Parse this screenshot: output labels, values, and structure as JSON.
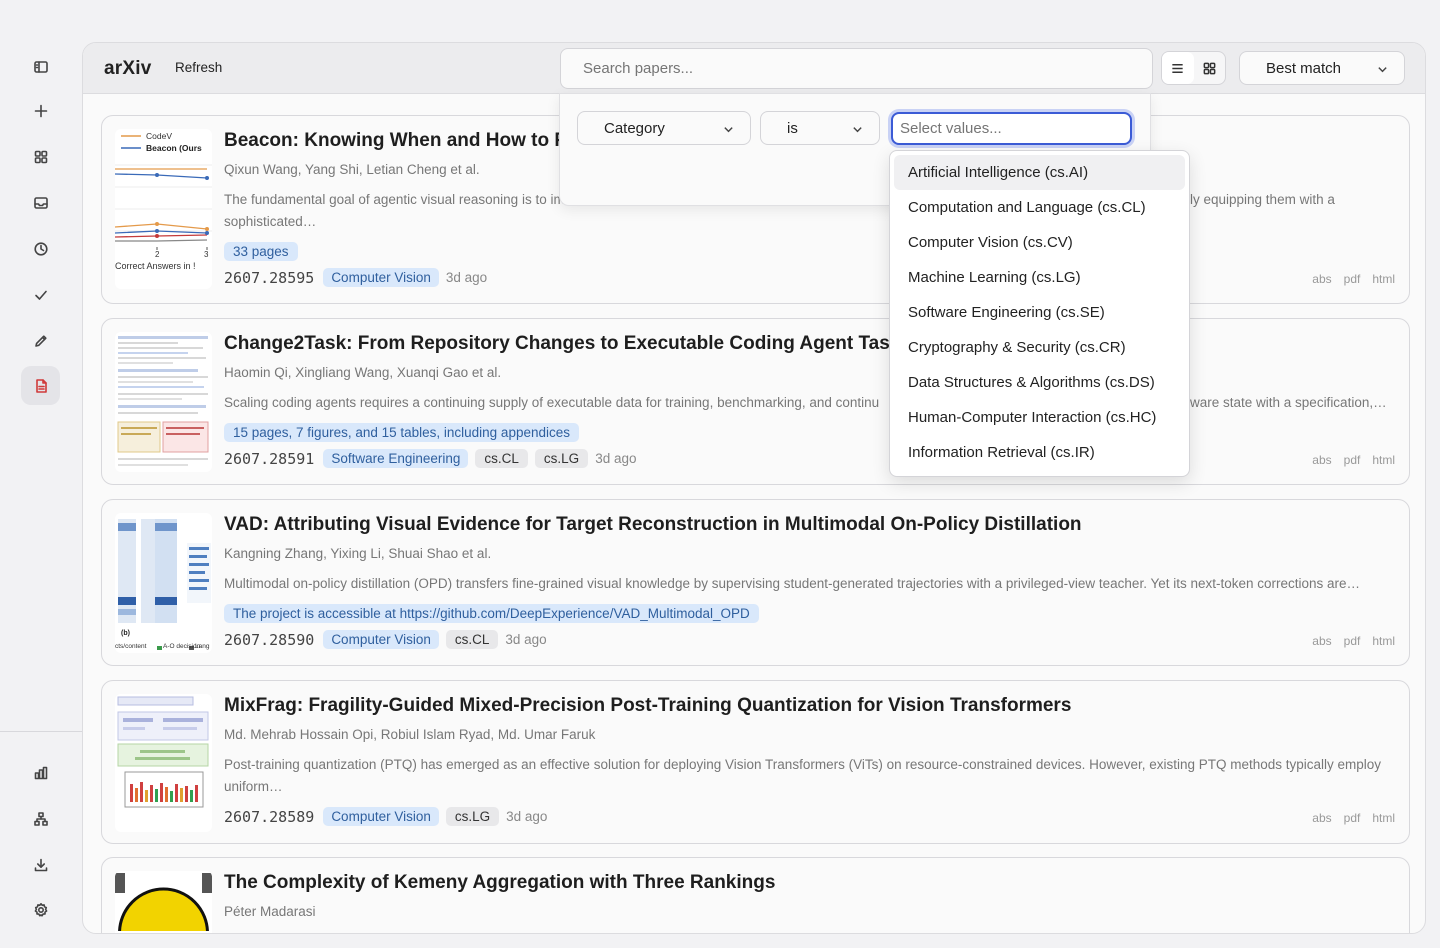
{
  "rail": {
    "top_items": [
      "sidebar-toggle-icon",
      "plus-icon",
      "grid-icon",
      "inbox-icon",
      "clock-icon",
      "check-icon",
      "pencil-icon",
      "document-icon"
    ],
    "bottom_items": [
      "bar-chart-icon",
      "network-icon",
      "download-icon",
      "gear-icon"
    ],
    "active": "document-icon"
  },
  "header": {
    "title": "arXiv",
    "refresh_label": "Refresh",
    "search_placeholder": "Search papers...",
    "sort_label": "Best match"
  },
  "filter": {
    "field": "Category",
    "operator": "is",
    "values_placeholder": "Select values...",
    "options": [
      "Artificial Intelligence (cs.AI)",
      "Computation and Language (cs.CL)",
      "Computer Vision (cs.CV)",
      "Machine Learning (cs.LG)",
      "Software Engineering (cs.SE)",
      "Cryptography & Security (cs.CR)",
      "Data Structures & Algorithms (cs.DS)",
      "Human-Computer Interaction (cs.HC)",
      "Information Retrieval (cs.IR)"
    ]
  },
  "papers": [
    {
      "title": "Beacon: Knowing When and How to Pe",
      "authors": "Qixun Wang, Yang Shi, Letian Cheng et al.",
      "abstract_1": "The fundamental goal of agentic visual reasoning is to im",
      "abstract_1b": "ly equipping them with a",
      "abstract_2": "sophisticated…",
      "note": "33 pages",
      "id": "2607.28595",
      "primary": "Computer Vision",
      "secondary": [],
      "age": "3d ago",
      "thumb_text": [
        "CodeV",
        "Beacon (Ours",
        "2",
        "3",
        "Correct Answers in !"
      ]
    },
    {
      "title": "Change2Task: From Repository Changes to Executable Coding Agent Tasks ar",
      "authors": "Haomin Qi, Xingliang Wang, Xuanqi Gao et al.",
      "abstract_1": "Scaling coding agents requires a continuing supply of executable data for training, benchmarking, and continu",
      "abstract_1b": "ware state with a specification,…",
      "note": "15 pages, 7 figures, and 15 tables, including appendices",
      "id": "2607.28591",
      "primary": "Software Engineering",
      "secondary": [
        "cs.CL",
        "cs.LG"
      ],
      "age": "3d ago"
    },
    {
      "title": "VAD: Attributing Visual Evidence for Target Reconstruction in Multimodal On-Policy Distillation",
      "authors": "Kangning Zhang, Yixing Li, Shuai Shao et al.",
      "abstract_1": "Multimodal on-policy distillation (OPD) transfers fine-grained visual knowledge by supervising student-generated trajectories with a privileged-view teacher. Yet its next-token corrections are…",
      "note": "The project is accessible at https://github.com/DeepExperience/VAD_Multimodal_OPD",
      "id": "2607.28590",
      "primary": "Computer Vision",
      "secondary": [
        "cs.CL"
      ],
      "age": "3d ago",
      "thumb_text": [
        "(b)",
        "cts/content",
        "A-O decision",
        "Lang"
      ]
    },
    {
      "title": "MixFrag: Fragility-Guided Mixed-Precision Post-Training Quantization for Vision Transformers",
      "authors": "Md. Mehrab Hossain Opi, Robiul Islam Ryad, Md. Umar Faruk",
      "abstract_1": "Post-training quantization (PTQ) has emerged as an effective solution for deploying Vision Transformers (ViTs) on resource-constrained devices. However, existing PTQ methods typically employ",
      "abstract_2": "uniform…",
      "id": "2607.28589",
      "primary": "Computer Vision",
      "secondary": [
        "cs.LG"
      ],
      "age": "3d ago"
    },
    {
      "title": "The Complexity of Kemeny Aggregation with Three Rankings",
      "authors": "Péter Madarasi"
    }
  ],
  "links": [
    "abs",
    "pdf",
    "html"
  ],
  "colors": {
    "accent": "#3b5bd6",
    "pill_bg": "#d9e8fb",
    "pill_text": "#2f5f9e",
    "active_icon": "#d03a3a"
  }
}
